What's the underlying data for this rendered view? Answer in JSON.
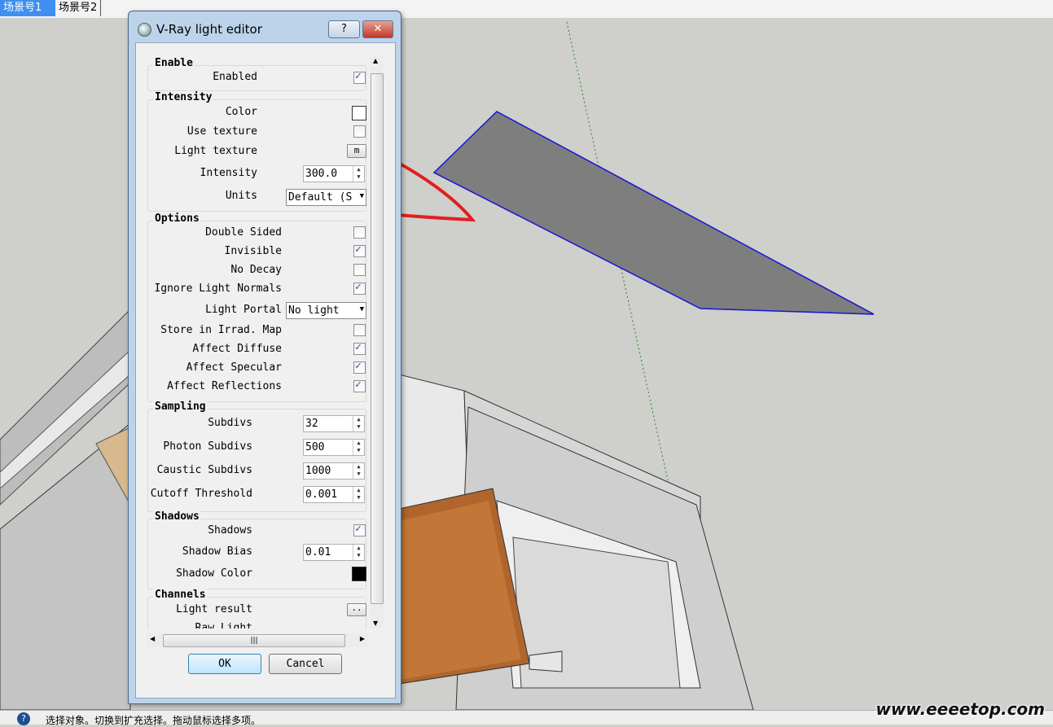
{
  "scene_tabs": [
    "场景号1",
    "场景号2"
  ],
  "dialog": {
    "title": "V-Ray light editor",
    "help_label": "?",
    "close_label": "✕",
    "ok_label": "OK",
    "cancel_label": "Cancel",
    "hscroll_grip": "|||",
    "enable": {
      "title": "Enable",
      "enabled_label": "Enabled",
      "enabled": true
    },
    "intensity": {
      "title": "Intensity",
      "color_label": "Color",
      "color": "#ffffff",
      "use_texture_label": "Use texture",
      "use_texture": false,
      "light_texture_label": "Light texture",
      "light_texture_button": "m",
      "intensity_label": "Intensity",
      "intensity_value": "300.0",
      "units_label": "Units",
      "units_value": "Default (S"
    },
    "options": {
      "title": "Options",
      "double_sided_label": "Double Sided",
      "double_sided": false,
      "invisible_label": "Invisible",
      "invisible": true,
      "no_decay_label": "No Decay",
      "no_decay": false,
      "ignore_normals_label": "Ignore Light Normals",
      "ignore_normals": true,
      "light_portal_label": "Light Portal",
      "light_portal_value": "No light",
      "store_irrad_label": "Store in Irrad. Map",
      "store_irrad": false,
      "affect_diffuse_label": "Affect Diffuse",
      "affect_diffuse": true,
      "affect_specular_label": "Affect Specular",
      "affect_specular": true,
      "affect_reflections_label": "Affect Reflections",
      "affect_reflections": true
    },
    "sampling": {
      "title": "Sampling",
      "subdivs_label": "Subdivs",
      "subdivs_value": "32",
      "photon_label": "Photon Subdivs",
      "photon_value": "500",
      "caustic_label": "Caustic Subdivs",
      "caustic_value": "1000",
      "cutoff_label": "Cutoff Threshold",
      "cutoff_value": "0.001"
    },
    "shadows": {
      "title": "Shadows",
      "shadows_label": "Shadows",
      "shadows": true,
      "bias_label": "Shadow Bias",
      "bias_value": "0.01",
      "color_label": "Shadow Color",
      "color": "#000000"
    },
    "channels": {
      "title": "Channels",
      "light_result_label": "Light result",
      "light_result_button": "..",
      "raw_light_label": "Raw Light"
    }
  },
  "status_bar": {
    "help_icon": "?",
    "message": "选择对象。切换到扩充选择。拖动鼠标选择多项。"
  },
  "watermark": "www.eeeetop.com",
  "colors": {
    "annotation": "#e02020",
    "tab_active": "#3f8ff0",
    "plane_edge": "#1414d8"
  }
}
